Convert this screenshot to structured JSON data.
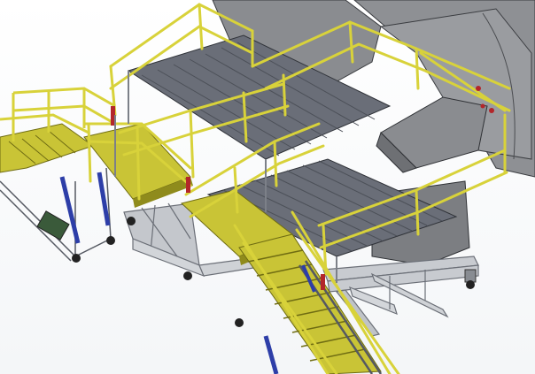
{
  "scene": {
    "subject": "cad-render-aircraft-maintenance-access-platform",
    "colors": {
      "background": "#ffffff",
      "railing_yellow": "#d8d23a",
      "railing_dark": "#6f6c12",
      "deck_steel": "#6a6e78",
      "deck_steel_dark": "#4c5058",
      "aircraft_skin": "#8a8c90",
      "aircraft_skin_light": "#a4a6aa",
      "frame_silver": "#c8cbd0",
      "frame_dark": "#7c8088",
      "actuator_blue": "#2d3ea8",
      "accent_red": "#b3262a",
      "caster_black": "#222222",
      "stair_tread": "#c9c436"
    }
  }
}
